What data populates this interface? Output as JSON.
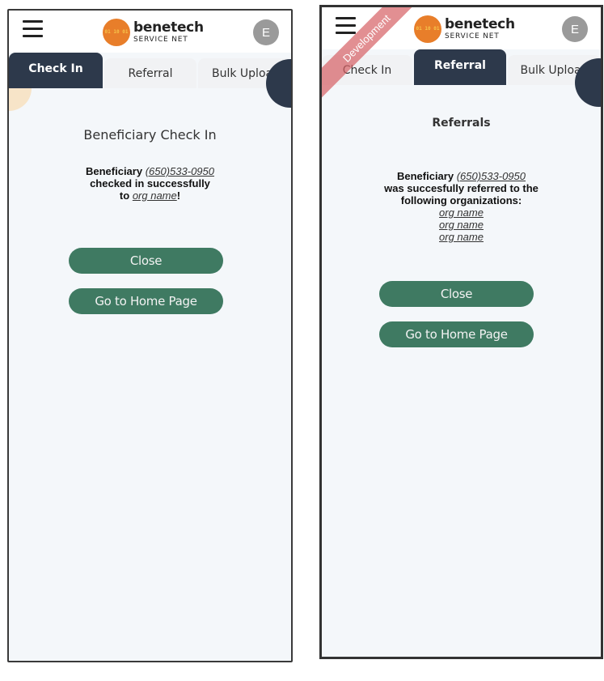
{
  "brand": {
    "name": "benetech",
    "sub": "SERVICE NET",
    "logo_mark": "01 10 01"
  },
  "avatar_initial": "E",
  "tabs": [
    "Check In",
    "Referral",
    "Bulk Upload"
  ],
  "left": {
    "title": "Beneficiary Check In",
    "msg_word": "Beneficiary",
    "phone": "(650)533-0950",
    "checked": "checked in successfully",
    "to": "to",
    "org": "org name",
    "exclaim": "!",
    "close_btn": "Close",
    "home_btn": "Go to Home Page"
  },
  "right": {
    "ribbon": "Development",
    "title": "Referrals",
    "msg_word": "Beneficiary",
    "phone": "(650)533-0950",
    "line2": "was succesfully referred to the",
    "line3": "following organizations:",
    "orgs": [
      "org name",
      "org name",
      "org name"
    ],
    "close_btn": "Close",
    "home_btn": "Go to Home Page"
  },
  "colors": {
    "nav_dark": "#2d394b",
    "button_green": "#3f7a62",
    "logo_orange": "#e87e2a",
    "ribbon": "#d65f64"
  }
}
